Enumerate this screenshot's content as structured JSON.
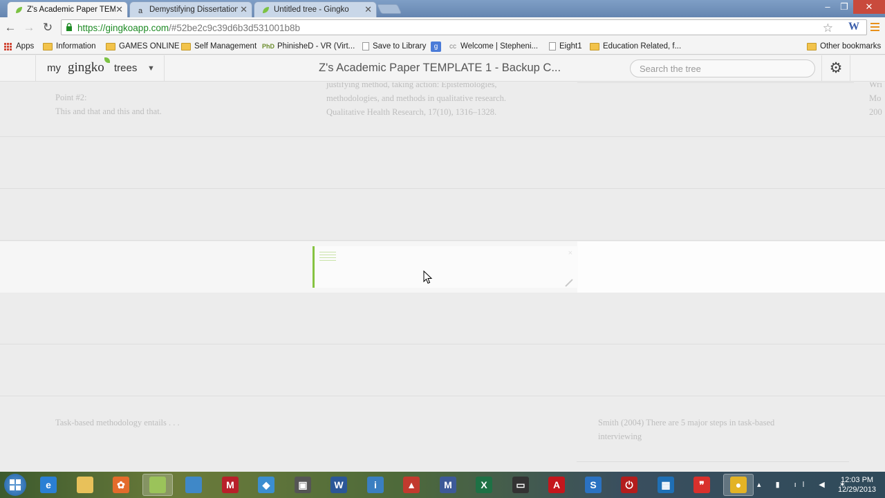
{
  "browser": {
    "tabs": [
      {
        "title": "Z's Academic Paper TEMP",
        "active": true,
        "close": "✕"
      },
      {
        "title": "Demystifying Dissertation",
        "active": false,
        "close": "✕"
      },
      {
        "title": "Untitled tree - Gingko",
        "active": false,
        "close": "✕"
      }
    ],
    "window_controls": {
      "minimize": "–",
      "restore": "❐",
      "close": "✕"
    },
    "nav": {
      "back": "←",
      "forward": "→",
      "reload": "↻"
    },
    "url_host": "https://gingkoapp.com",
    "url_path": "/#52be2c9c39d6b3d531001b8b",
    "star": "☆",
    "extension": "W"
  },
  "bookmarks": [
    {
      "label": "Apps",
      "icon": "apps-grid-icon"
    },
    {
      "label": "Information",
      "icon": "folder-icon"
    },
    {
      "label": "GAMES ONLINE",
      "icon": "folder-icon"
    },
    {
      "label": "Self Management",
      "icon": "folder-icon"
    },
    {
      "label": "PhinisheD - VR (Virt...",
      "icon": "phd-icon"
    },
    {
      "label": "Save to Library",
      "icon": "page-icon"
    },
    {
      "label": "",
      "icon": "google-plus-icon"
    },
    {
      "label": "Welcome | Stepheni...",
      "icon": "cc-icon"
    },
    {
      "label": "Eight1",
      "icon": "page-icon"
    },
    {
      "label": "Education Related, f...",
      "icon": "folder-icon"
    },
    {
      "label": "Other bookmarks",
      "icon": "folder-icon"
    }
  ],
  "app": {
    "brand_my": "my",
    "brand_gingko": "gingko",
    "brand_trees": "trees",
    "brand_caret": "▼",
    "tree_title": "Z's Academic Paper TEMPLATE 1 - Backup C...",
    "search_placeholder": "Search the tree",
    "settings_icon": "⚙"
  },
  "cards": {
    "top_left_line1": "Point #2:",
    "top_left_line2": "This and that and this and that.",
    "top_mid_line1": "justifying method, taking action: Epistemologies,",
    "top_mid_line2": "methodologies, and methods in qualitative research.",
    "top_mid_line3": "Qualitative Health Research, 17(10), 1316–1328.",
    "top_right_line1": "Wri",
    "top_right_line2": "Mo",
    "top_right_line3": "200",
    "bottom_left": "Task-based methodology entails . . .",
    "bottom_right_line1": "Smith (2004) There are 5 major steps in task-based",
    "bottom_right_line2": "interviewing",
    "editor_close": "×"
  },
  "taskbar": {
    "apps": [
      {
        "name": "internet-explorer",
        "label": "e",
        "color": "#2a7fd4"
      },
      {
        "name": "file-explorer",
        "label": "",
        "color": "#e8c15a"
      },
      {
        "name": "flower-app",
        "label": "✿",
        "color": "#e36b2b"
      },
      {
        "name": "gingko-notes",
        "label": "",
        "color": "#9bc35a"
      },
      {
        "name": "window-app",
        "label": "",
        "color": "#3f88c8"
      },
      {
        "name": "mendeley",
        "label": "M",
        "color": "#b8202a"
      },
      {
        "name": "map-app",
        "label": "◆",
        "color": "#3b8ed0"
      },
      {
        "name": "camera-app",
        "label": "▣",
        "color": "#555555"
      },
      {
        "name": "word",
        "label": "W",
        "color": "#2b5797"
      },
      {
        "name": "tips-app",
        "label": "i",
        "color": "#3a7fc1"
      },
      {
        "name": "red-app",
        "label": "▲",
        "color": "#c23a2e"
      },
      {
        "name": "mathtype",
        "label": "M",
        "color": "#3d5a98"
      },
      {
        "name": "excel",
        "label": "X",
        "color": "#1e7145"
      },
      {
        "name": "terminal-app",
        "label": "▭",
        "color": "#333333"
      },
      {
        "name": "acrobat",
        "label": "A",
        "color": "#c4161c"
      },
      {
        "name": "outlook-app",
        "label": "S",
        "color": "#2b72c2"
      },
      {
        "name": "power-app",
        "label": "⏻",
        "color": "#b31d1d"
      },
      {
        "name": "remote-app",
        "label": "▦",
        "color": "#1f6fb5"
      },
      {
        "name": "quote-app",
        "label": "❞",
        "color": "#d9302c"
      },
      {
        "name": "chrome",
        "label": "●",
        "color": "#e3b325"
      }
    ],
    "tray": "▴ ▮ ıl ◀ ✶",
    "time": "12:03 PM",
    "date": "12/29/2013"
  }
}
